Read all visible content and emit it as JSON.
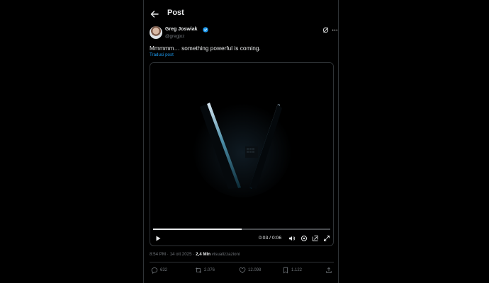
{
  "header": {
    "title": "Post"
  },
  "author": {
    "name": "Greg Joswiak",
    "handle": "@gregjoz"
  },
  "post": {
    "text": "Mmmmm… something powerful is coming.",
    "translate_label": "Traduci post"
  },
  "video": {
    "current_time": "0:03",
    "duration": "0:06",
    "time_display": "0:03 / 0:06",
    "progress": 0.5
  },
  "meta": {
    "time": "8:54 PM",
    "date": "14 ott 2025",
    "separator": "·",
    "views": "2,4 Mln",
    "views_label": "visualizzazioni"
  },
  "actions": {
    "replies": "632",
    "reposts": "2.076",
    "likes": "12.098",
    "bookmarks": "1.122"
  },
  "colors": {
    "accent": "#1d9bf0",
    "background": "#000000",
    "muted": "#71767b"
  }
}
